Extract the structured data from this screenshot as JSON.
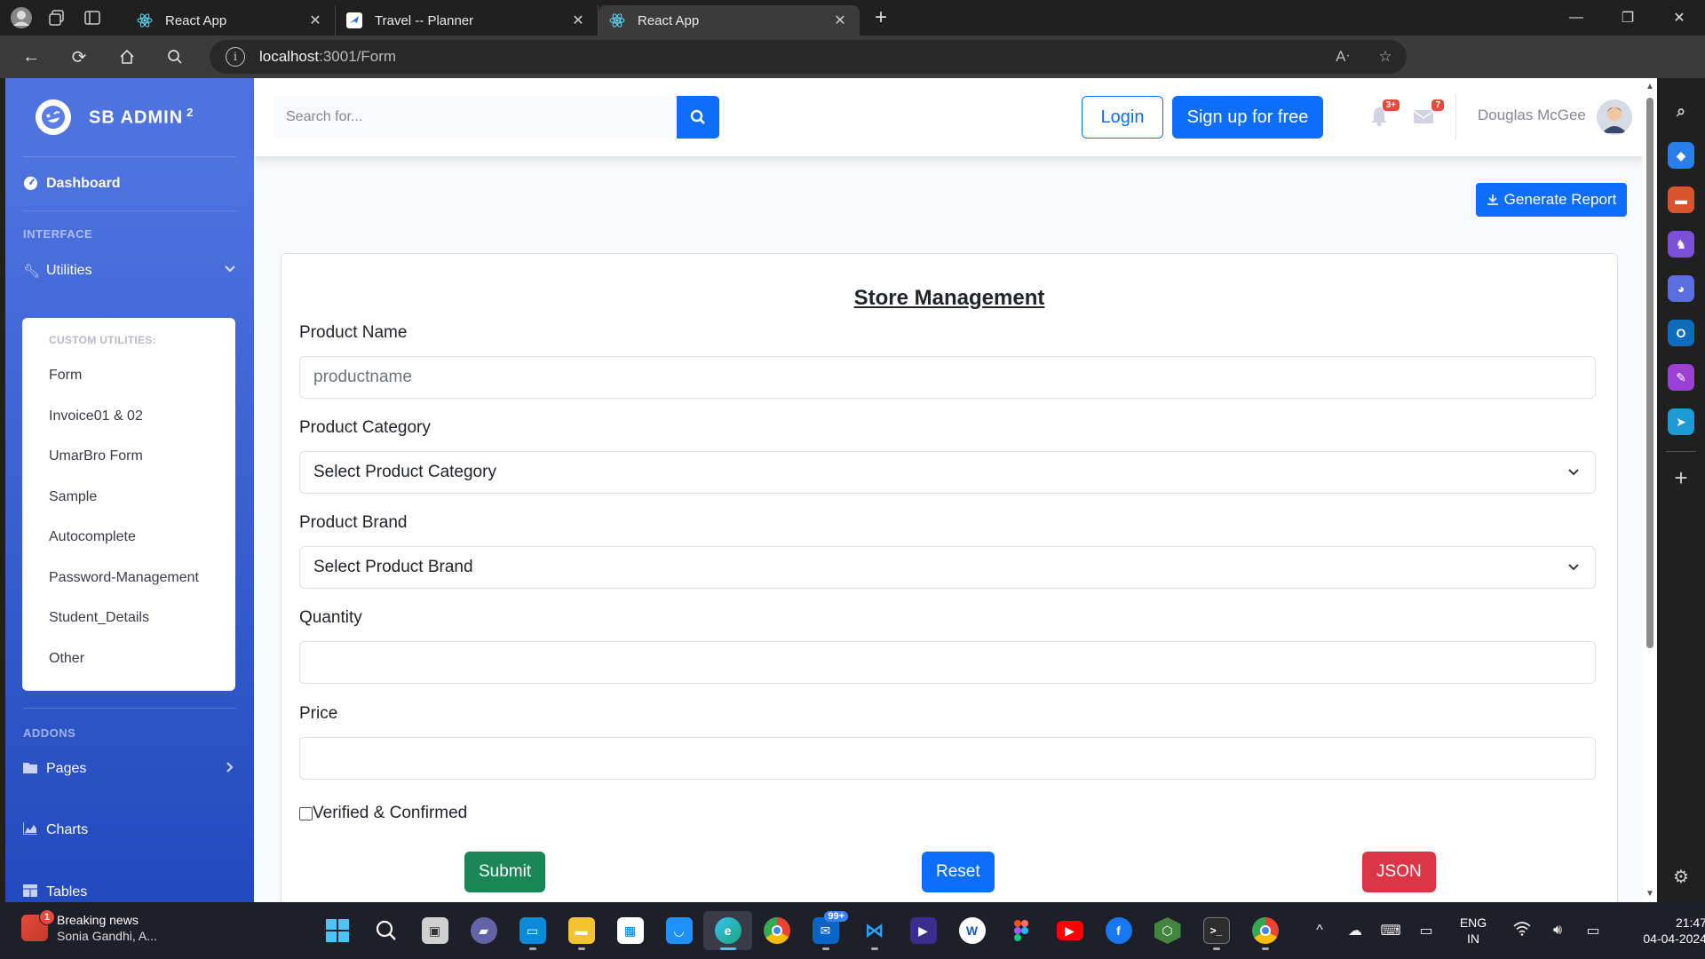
{
  "browser": {
    "tabs": [
      {
        "title": "React App",
        "active": false
      },
      {
        "title": "Travel -- Planner",
        "active": false
      },
      {
        "title": "React App",
        "active": true
      }
    ],
    "url_host": "localhost",
    "url_path": ":3001/Form"
  },
  "sidebar": {
    "brand": "SB ADMIN",
    "brand_sup": "2",
    "dashboard": "Dashboard",
    "interface_heading": "INTERFACE",
    "utilities": "Utilities",
    "custom_heading": "CUSTOM UTILITIES:",
    "custom_items": [
      "Form",
      "Invoice01 & 02",
      "UmarBro Form",
      "Sample",
      "Autocomplete",
      "Password-Management",
      "Student_Details",
      "Other"
    ],
    "addons_heading": "ADDONS",
    "pages": "Pages",
    "charts": "Charts",
    "tables": "Tables"
  },
  "topbar": {
    "search_placeholder": "Search for...",
    "login": "Login",
    "signup": "Sign up for free",
    "alerts_badge": "3+",
    "messages_badge": "7",
    "username": "Douglas McGee"
  },
  "content": {
    "report_button": "Generate Report",
    "form_title": "Store Management",
    "product_name_label": "Product Name",
    "product_name_placeholder": "productname",
    "category_label": "Product Category",
    "category_value": "Select Product Category",
    "brand_label": "Product Brand",
    "brand_value": "Select Product Brand",
    "quantity_label": "Quantity",
    "price_label": "Price",
    "verified_label": "Verified & Confirmed",
    "submit": "Submit",
    "reset": "Reset",
    "json": "JSON"
  },
  "colors": {
    "primary": "#0d6efd",
    "success": "#198754",
    "danger": "#dc3545",
    "sidebar": "#4e73df"
  },
  "taskbar": {
    "news_title": "Breaking news",
    "news_sub": "Sonia Gandhi, A...",
    "news_badge": "1",
    "mail_badge": "99+",
    "lang_line1": "ENG",
    "lang_line2": "IN",
    "time": "21:47",
    "date": "04-04-2024"
  }
}
